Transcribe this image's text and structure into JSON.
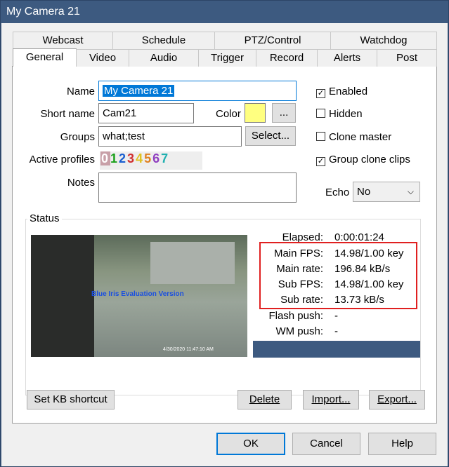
{
  "window": {
    "title": "My Camera 21"
  },
  "tabs_row1": [
    "Webcast",
    "Schedule",
    "PTZ/Control",
    "Watchdog"
  ],
  "tabs_row2": [
    "General",
    "Video",
    "Audio",
    "Trigger",
    "Record",
    "Alerts",
    "Post"
  ],
  "form": {
    "name_label": "Name",
    "name_value": "My Camera 21",
    "short_name_label": "Short name",
    "short_name_value": "Cam21",
    "color_label": "Color",
    "color_value": "#ffff80",
    "color_button": "...",
    "groups_label": "Groups",
    "groups_value": "what;test",
    "groups_button": "Select...",
    "active_profiles_label": "Active profiles",
    "profiles": [
      "0",
      "1",
      "2",
      "3",
      "4",
      "5",
      "6",
      "7"
    ],
    "profile_colors": [
      "#ffffff",
      "#1aa01a",
      "#1a5fd0",
      "#d03030",
      "#e0c020",
      "#e08020",
      "#9040c0",
      "#20b0b0"
    ],
    "notes_label": "Notes",
    "notes_value": ""
  },
  "checks": {
    "enabled": {
      "label": "Enabled",
      "checked": true
    },
    "hidden": {
      "label": "Hidden",
      "checked": false
    },
    "clone_master": {
      "label": "Clone master",
      "checked": false
    },
    "group_clone_clips": {
      "label": "Group clone clips",
      "checked": true
    }
  },
  "echo": {
    "label": "Echo",
    "value": "No"
  },
  "status": {
    "label": "Status",
    "watermark": "Blue Iris Evaluation Version",
    "timestamp": "4/30/2020 11:47:10 AM",
    "elapsed_label": "Elapsed:",
    "elapsed_value": "0:00:01:24",
    "main_fps_label": "Main FPS:",
    "main_fps_value": "14.98/1.00 key",
    "main_rate_label": "Main rate:",
    "main_rate_value": "196.84 kB/s",
    "sub_fps_label": "Sub FPS:",
    "sub_fps_value": "14.98/1.00 key",
    "sub_rate_label": "Sub rate:",
    "sub_rate_value": "13.73 kB/s",
    "flash_label": "Flash push:",
    "flash_value": "-",
    "wm_label": "WM push:",
    "wm_value": "-",
    "bar_color": "#3d5a80"
  },
  "buttons": {
    "shortcut": "Set KB shortcut",
    "delete": "Delete",
    "import": "Import...",
    "export": "Export...",
    "ok": "OK",
    "cancel": "Cancel",
    "help": "Help"
  }
}
